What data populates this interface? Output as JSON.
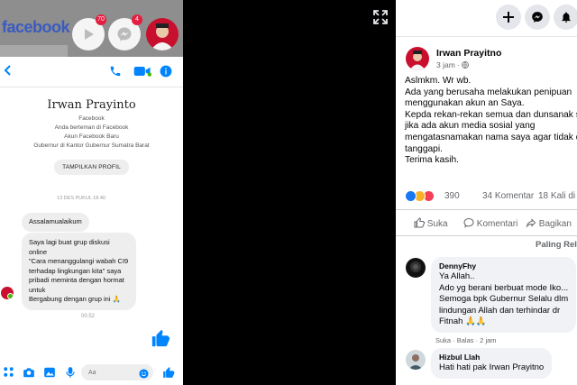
{
  "phone": {
    "fb_word": "facebook",
    "chathead_badges": [
      "70",
      "4"
    ],
    "profile": {
      "name": "Irwan Prayinto",
      "lines": [
        "Facebook",
        "Anda berteman di Facebook",
        "Akun Facebook Baru",
        "Gubernur di Kantor Gubernur Sumatra Barat"
      ],
      "view_profile_label": "TAMPILKAN PROFIL"
    },
    "date_separator": "13 DES PUKUL 18.40",
    "messages": [
      {
        "lines": [
          "Assalamualaikum"
        ]
      },
      {
        "lines": [
          "Saya lagi buat grup diskusi online",
          "\"Cara menanggulangi wabah CI9",
          "terhadap lingkungan kita\" saya",
          "pribadi meminta dengan hormat",
          "untuk",
          "Bergabung dengan grup ini 🙏"
        ]
      }
    ],
    "time_separator": "00.52",
    "composer_placeholder": "Aa"
  },
  "post": {
    "author": "Irwan Prayitno",
    "time": "3 jam ·",
    "text_lines": [
      "Aslmkm. Wr wb.",
      "Ada yang berusaha melakukan penipuan",
      "menggunakan akun an Saya.",
      "Kepda rekan-rekan semua dan dunsanak s",
      "jika ada akun media sosial yang",
      "mengatasnamakan nama saya agar tidak d",
      "tanggapi.",
      "Terima kasih."
    ],
    "reaction_count": "390",
    "comment_count": "34 Komentar",
    "share_count": "18 Kali di",
    "actions": {
      "like": "Suka",
      "comment": "Komentari",
      "share": "Bagikan"
    },
    "sort_label": "Paling Rel"
  },
  "comments": [
    {
      "author": "DennyFhy",
      "lines": [
        "Ya Allah..",
        "Ado yg berani berbuat mode Iko...",
        "Semoga bpk Gubernur Selalu dlm",
        "lindungan Allah dan terhindar dr",
        "Fitnah 🙏🙏"
      ],
      "meta": "Suka · Balas · 2 jam"
    },
    {
      "author": "Hizbul Llah",
      "lines": [
        "Hati hati pak Irwan Prayitno"
      ]
    }
  ],
  "colors": {
    "fb_blue": "#1877f2",
    "messenger_blue": "#0084ff",
    "panel_gray": "#f0f2f5",
    "text_gray": "#65676b",
    "viewer_bg": "#000000"
  },
  "icons": [
    "back-chevron-icon",
    "phone-icon",
    "video-icon",
    "info-icon",
    "expand-icon",
    "plus-icon",
    "messenger-icon",
    "like-thumb-icon",
    "comment-icon",
    "share-icon",
    "globe-icon",
    "camera-icon",
    "image-icon",
    "mic-icon",
    "emoji-icon",
    "grid-icon"
  ]
}
